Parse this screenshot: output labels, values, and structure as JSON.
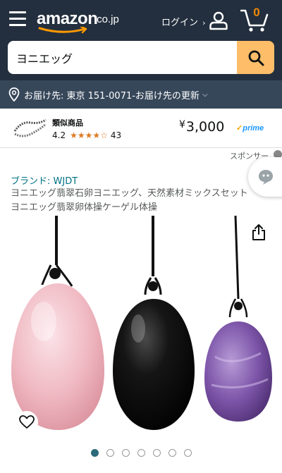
{
  "header": {
    "logo_text": "amazon",
    "logo_tld": ".co.jp",
    "login_label": "ログイン",
    "login_chevron": "›",
    "cart_count": "0",
    "icons": [
      "menu-icon",
      "user-icon",
      "cart-icon"
    ]
  },
  "search": {
    "query": "ヨニエッグ",
    "button_icon": "search-icon"
  },
  "delivery": {
    "text": "お届け先: 東京 151-0071-お届け先の更新",
    "icon": "location-pin-icon"
  },
  "sponsored_product": {
    "title": "類似商品",
    "rating": "4.2",
    "stars": "★★★★☆",
    "rating_value": 4.2,
    "review_count": "43",
    "price_symbol": "¥",
    "price": "3,000",
    "prime_label": "prime"
  },
  "sponsored_label": "スポンサー",
  "product": {
    "brand": "ブランド: WJDT",
    "title": "ヨニエッグ翡翠石卵ヨニエッグ、天然素材ミックスセット ヨニエッグ翡翠卵体操ケーゲル体操"
  },
  "gallery": {
    "image_count": 7,
    "active_index": 0
  },
  "colors": {
    "header_bg": "#232f3e",
    "delivery_bg": "#37475a",
    "search_button": "#febd69",
    "cart_count": "#f08804",
    "link": "#007185",
    "star": "#de7921",
    "prime": "#1a98ff"
  }
}
